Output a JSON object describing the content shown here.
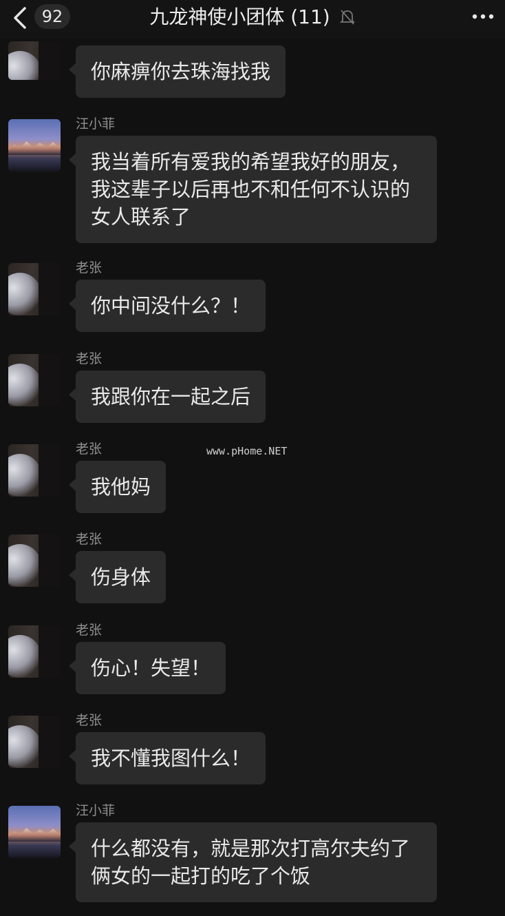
{
  "header": {
    "unread_count": "92",
    "title": "九龙神使小团体 (11)"
  },
  "messages": [
    {
      "sender": "",
      "text": "你麻痹你去珠海找我",
      "avatar": "dark-silhouette"
    },
    {
      "sender": "汪小菲",
      "text": "我当着所有爱我的希望我好的朋友，我这辈子以后再也不和任何不认识的女人联系了",
      "avatar": "mountain-sunset"
    },
    {
      "sender": "老张",
      "text": "你中间没什么？！",
      "avatar": "dark-silhouette"
    },
    {
      "sender": "老张",
      "text": "我跟你在一起之后",
      "avatar": "dark-silhouette"
    },
    {
      "sender": "老张",
      "text": "我他妈",
      "avatar": "dark-silhouette"
    },
    {
      "sender": "老张",
      "text": "伤身体",
      "avatar": "dark-silhouette"
    },
    {
      "sender": "老张",
      "text": "伤心！失望！",
      "avatar": "dark-silhouette"
    },
    {
      "sender": "老张",
      "text": "我不懂我图什么！",
      "avatar": "dark-silhouette"
    },
    {
      "sender": "汪小菲",
      "text": "什么都没有，就是那次打高尔夫约了俩女的一起打的吃了个饭",
      "avatar": "mountain-sunset"
    }
  ],
  "watermark": "www.pHome.NET",
  "colors": {
    "background": "#111111",
    "bubble": "#2b2b2b",
    "sender_name": "#8f8f8f",
    "text": "#e9e9e9"
  }
}
